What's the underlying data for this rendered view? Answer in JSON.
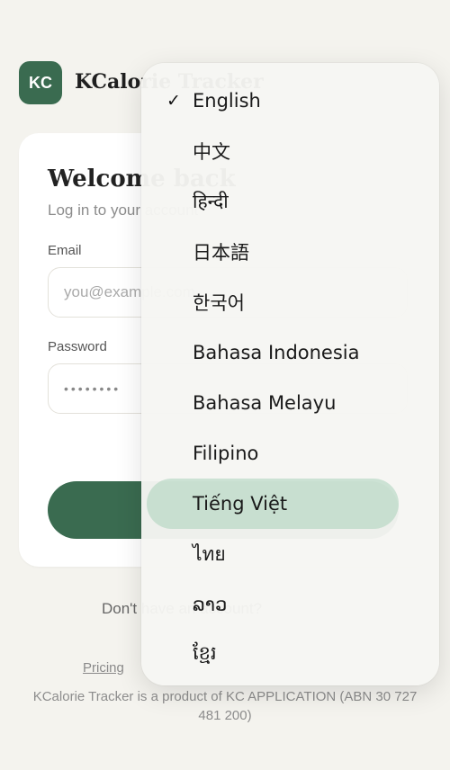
{
  "brand": {
    "logo_text": "KC",
    "name": "KCalorie Tracker"
  },
  "login": {
    "title": "Welcome back",
    "subtitle": "Log in to your account",
    "email_label": "Email",
    "email_placeholder": "you@example.com",
    "password_label": "Password",
    "password_value": "••••••••"
  },
  "signup_prompt": "Don't have an account?",
  "links": {
    "pricing": "Pricing"
  },
  "footer": "KCalorie Tracker is a product of KC APPLICATION (ABN 30 727 481 200)",
  "language_menu": {
    "selected": "English",
    "items": [
      {
        "label": "English",
        "checked": "✓"
      },
      {
        "label": "中文"
      },
      {
        "label": "हिन्दी"
      },
      {
        "label": "日本語"
      },
      {
        "label": "한국어"
      },
      {
        "label": "Bahasa Indonesia"
      },
      {
        "label": "Bahasa Melayu"
      },
      {
        "label": "Filipino"
      },
      {
        "label": "Tiếng Việt"
      },
      {
        "label": "ไทย"
      },
      {
        "label": "ລາວ"
      },
      {
        "label": "ខ្មែរ"
      }
    ]
  },
  "colors": {
    "brand_green": "#3a6b50",
    "highlight_green": "#b8d8c4",
    "background": "#f4f3ee"
  }
}
